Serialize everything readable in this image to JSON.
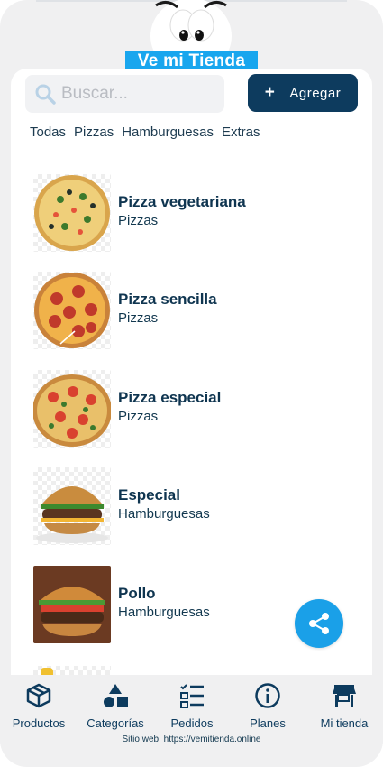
{
  "header": {
    "logo_text": "Ve mi Tienda"
  },
  "search": {
    "placeholder": "Buscar..."
  },
  "toolbar": {
    "add_label": "Agregar",
    "add_icon": "plus-icon"
  },
  "categories": [
    "Todas",
    "Pizzas",
    "Hamburguesas",
    "Extras"
  ],
  "products": [
    {
      "name": "Pizza vegetariana",
      "category": "Pizzas"
    },
    {
      "name": "Pizza sencilla",
      "category": "Pizzas"
    },
    {
      "name": "Pizza especial",
      "category": "Pizzas"
    },
    {
      "name": "Especial",
      "category": "Hamburguesas"
    },
    {
      "name": "Pollo",
      "category": "Hamburguesas"
    }
  ],
  "nav": [
    {
      "label": "Productos",
      "icon": "cube-icon"
    },
    {
      "label": "Categorías",
      "icon": "shapes-icon"
    },
    {
      "label": "Pedidos",
      "icon": "checklist-icon"
    },
    {
      "label": "Planes",
      "icon": "info-icon"
    },
    {
      "label": "Mi tienda",
      "icon": "store-icon"
    }
  ],
  "footer": {
    "site_text": "Sitio web: https://vemitienda.online"
  },
  "colors": {
    "primary": "#0d3b5e",
    "accent": "#1aa0e8",
    "logo_bg": "#19a6ee"
  }
}
